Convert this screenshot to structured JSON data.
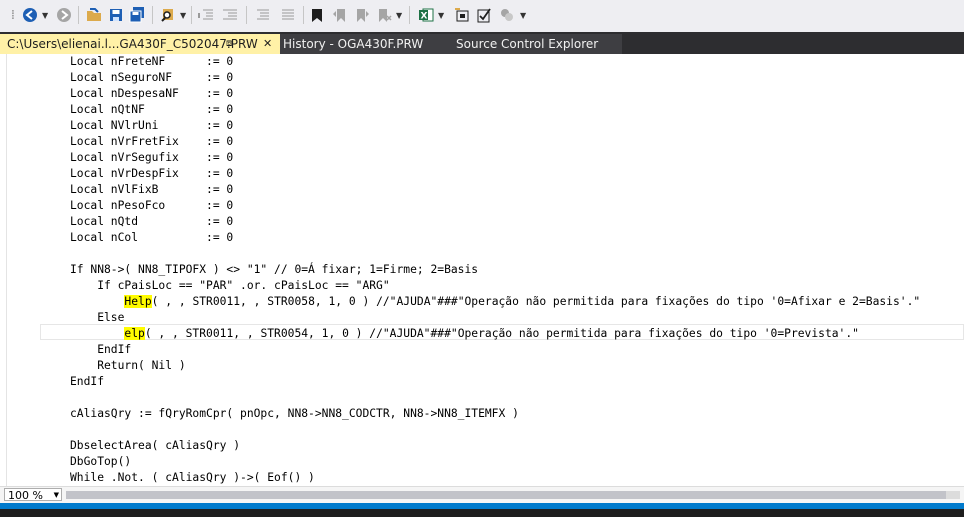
{
  "toolbar": {
    "icons": [
      "back-arrow-icon",
      "forward-arrow-icon",
      "open-folder-icon",
      "save-icon",
      "save-all-icon",
      "find-icon",
      "outdent-icon",
      "indent-icon",
      "align-icon",
      "comment-icon",
      "bookmark-icon",
      "prev-bookmark-icon",
      "next-bookmark-icon",
      "clear-bookmarks-icon",
      "excel-icon",
      "object-icon",
      "checklist-icon",
      "compare-icon"
    ]
  },
  "tabs": {
    "active": {
      "label": "C:\\Users\\elienai.l...GA430F_C502047.PRW",
      "pin": "⧈",
      "close": "✕"
    },
    "history": {
      "label": "History - OGA430F.PRW"
    },
    "source_control": {
      "label": "Source Control Explorer"
    }
  },
  "code": {
    "lines": [
      {
        "pre": "Local nFreteNF      := 0"
      },
      {
        "pre": "Local nSeguroNF     := 0"
      },
      {
        "pre": "Local nDespesaNF    := 0"
      },
      {
        "pre": "Local nQtNF         := 0"
      },
      {
        "pre": "Local NVlrUni       := 0"
      },
      {
        "pre": "Local nVrFretFix    := 0"
      },
      {
        "pre": "Local nVrSegufix    := 0"
      },
      {
        "pre": "Local nVrDespFix    := 0"
      },
      {
        "pre": "Local nVlFixB       := 0"
      },
      {
        "pre": "Local nPesoFco      := 0"
      },
      {
        "pre": "Local nQtd          := 0"
      },
      {
        "pre": "Local nCol          := 0"
      },
      {
        "pre": ""
      },
      {
        "pre": "If NN8->( NN8_TIPOFX ) <> \"1\" // 0=Á fixar; 1=Firme; 2=Basis"
      },
      {
        "pre": "    If cPaisLoc == \"PAR\" .or. cPaisLoc == \"ARG\""
      },
      {
        "pre": "        ",
        "hl": "Help",
        "post": "( , , STR0011, , STR0058, 1, 0 ) //\"AJUDA\"###\"Operação não permitida para fixações do tipo '0=Afixar e 2=Basis'.\""
      },
      {
        "pre": "    Else"
      },
      {
        "pre": "        ",
        "hl": "elp",
        "post": "( , , STR0011, , STR0054, 1, 0 ) //\"AJUDA\"###\"Operação não permitida para fixações do tipo '0=Prevista'.\""
      },
      {
        "pre": "    EndIf"
      },
      {
        "pre": "    Return( Nil )"
      },
      {
        "pre": "EndIf"
      },
      {
        "pre": ""
      },
      {
        "pre": "cAliasQry := fQryRomCpr( pnOpc, NN8->NN8_CODCTR, NN8->NN8_ITEMFX )"
      },
      {
        "pre": ""
      },
      {
        "pre": "DbselectArea( cAliasQry )"
      },
      {
        "pre": "DbGoTop()"
      },
      {
        "pre": "While .Not. ( cAliasQry )->( Eof() )"
      }
    ]
  },
  "status": {
    "zoom": "100 %",
    "zoom_arrow": "▼"
  }
}
